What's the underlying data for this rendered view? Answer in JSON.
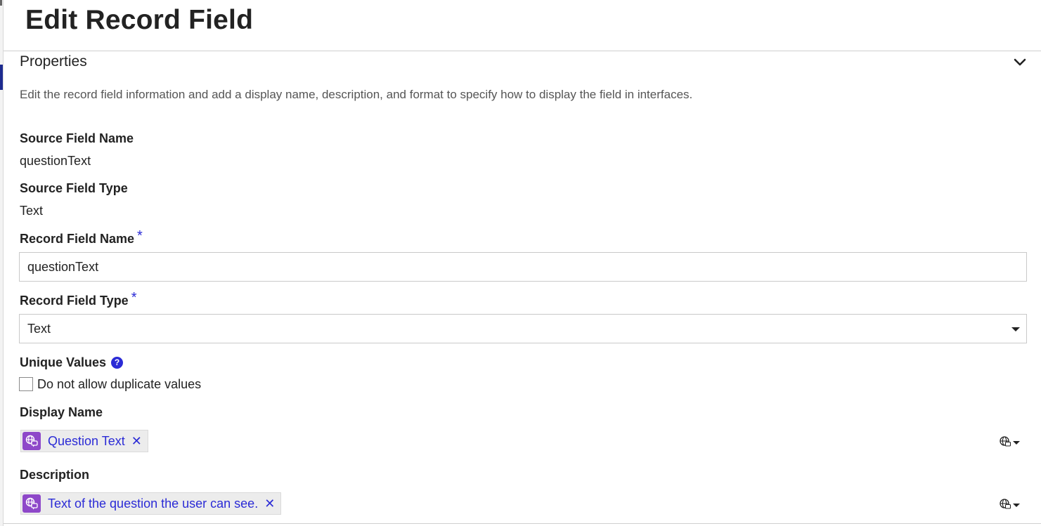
{
  "dialog": {
    "title": "Edit Record Field"
  },
  "section": {
    "title": "Properties",
    "description": "Edit the record field information and add a display name, description, and format to specify how to display the field in interfaces."
  },
  "fields": {
    "source_field_name": {
      "label": "Source Field Name",
      "value": "questionText"
    },
    "source_field_type": {
      "label": "Source Field Type",
      "value": "Text"
    },
    "record_field_name": {
      "label": "Record Field Name",
      "required_mark": "*",
      "value": "questionText"
    },
    "record_field_type": {
      "label": "Record Field Type",
      "required_mark": "*",
      "selected": "Text"
    },
    "unique_values": {
      "label": "Unique Values",
      "help_icon": "?",
      "checkbox_label": "Do not allow duplicate values",
      "checked": false
    },
    "display_name": {
      "label": "Display Name",
      "token": "Question Text",
      "remove_glyph": "✕"
    },
    "description": {
      "label": "Description",
      "token": "Text of the question the user can see.",
      "remove_glyph": "✕"
    }
  },
  "icons": {
    "collapse": "chevron-down-icon",
    "translation": "translation-icon",
    "locale": "globe-icon",
    "help": "question-circle-icon"
  },
  "colors": {
    "accent": "#2b2bd6",
    "token_icon_bg": "#8e48c9",
    "token_bg": "#ececec",
    "border": "#c9c9c9",
    "description_text": "#555555"
  }
}
